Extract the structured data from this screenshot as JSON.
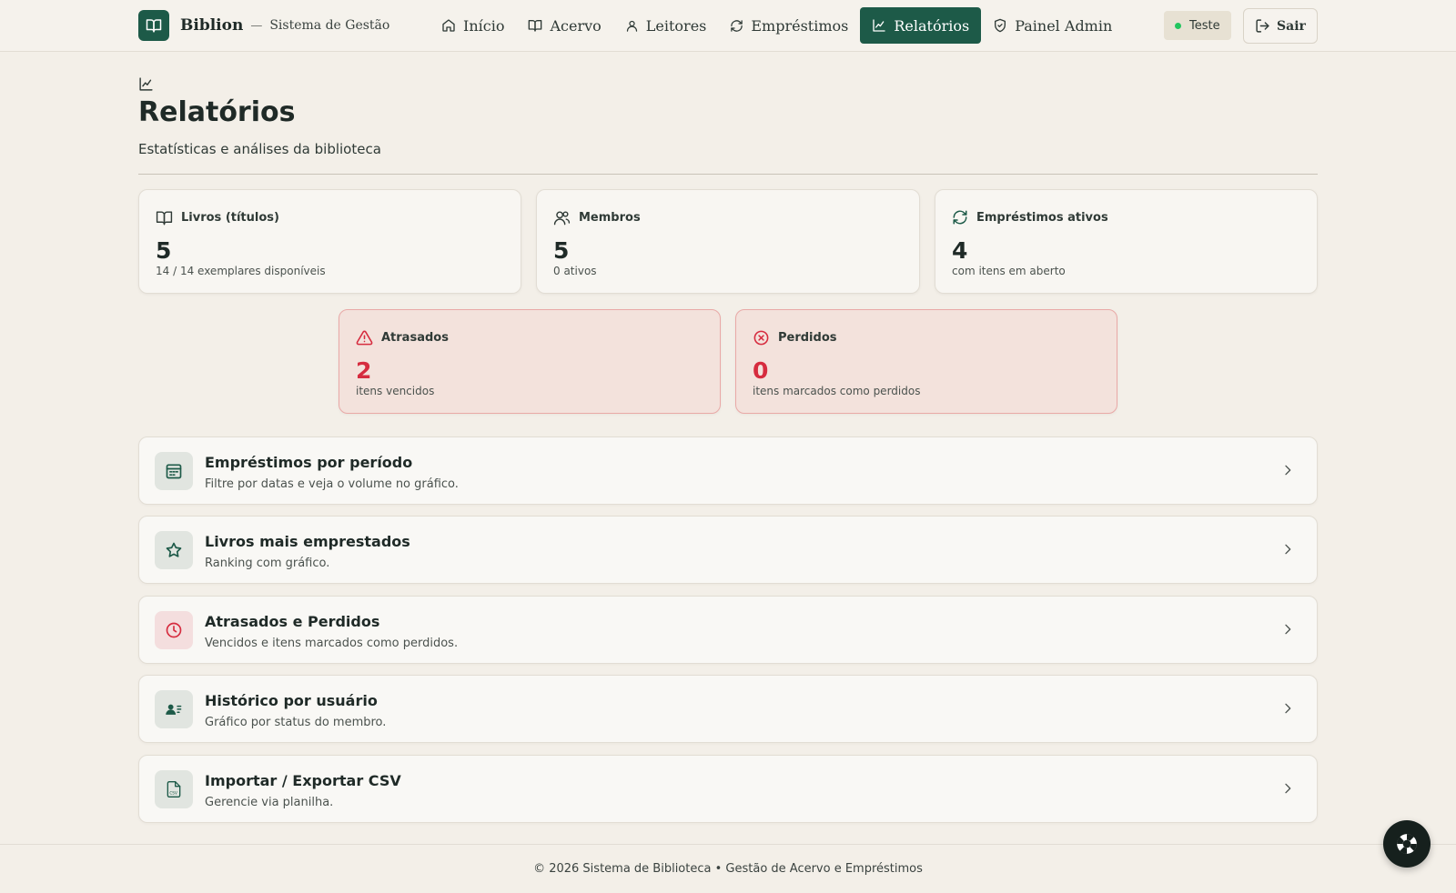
{
  "brand": {
    "name": "Biblion",
    "separator": "—",
    "subtitle": "Sistema de Gestão",
    "logo_icon": "book-open-icon"
  },
  "nav": {
    "items": [
      {
        "label": "Início",
        "icon": "home-icon",
        "active": false
      },
      {
        "label": "Acervo",
        "icon": "book-open-icon",
        "active": false
      },
      {
        "label": "Leitores",
        "icon": "user-icon",
        "active": false
      },
      {
        "label": "Empréstimos",
        "icon": "refresh-icon",
        "active": false
      },
      {
        "label": "Relatórios",
        "icon": "chart-line-icon",
        "active": true
      },
      {
        "label": "Painel Admin",
        "icon": "shield-check-icon",
        "active": false
      }
    ]
  },
  "env_badge": {
    "label": "Teste",
    "dot_color": "#22c55e"
  },
  "logout": {
    "label": "Sair",
    "icon": "logout-icon"
  },
  "header": {
    "title": "Relatórios",
    "subtitle": "Estatísticas e análises da biblioteca",
    "icon": "chart-line-icon"
  },
  "stats": [
    {
      "label": "Livros (títulos)",
      "value": "5",
      "note": "14 / 14 exemplares disponíveis",
      "icon": "book-open-icon"
    },
    {
      "label": "Membros",
      "value": "5",
      "note": "0 ativos",
      "icon": "users-icon"
    },
    {
      "label": "Empréstimos ativos",
      "value": "4",
      "note": "com itens em aberto",
      "icon": "refresh-icon"
    },
    {
      "label": "Atrasados",
      "value": "2",
      "note": "itens vencidos",
      "icon": "alert-triangle-icon"
    },
    {
      "label": "Perdidos",
      "value": "0",
      "note": "itens marcados como perdidos",
      "icon": "x-circle-icon"
    }
  ],
  "reports": [
    {
      "title": "Empréstimos por período",
      "desc": "Filtre por datas e veja o volume no gráfico.",
      "icon": "calendar-icon"
    },
    {
      "title": "Livros mais emprestados",
      "desc": "Ranking com gráfico.",
      "icon": "star-icon"
    },
    {
      "title": "Atrasados e Perdidos",
      "desc": "Vencidos e itens marcados como perdidos.",
      "icon": "clock-icon"
    },
    {
      "title": "Histórico por usuário",
      "desc": "Gráfico por status do membro.",
      "icon": "user-list-icon"
    },
    {
      "title": "Importar / Exportar CSV",
      "desc": "Gerencie via planilha.",
      "icon": "csv-file-icon"
    }
  ],
  "footer": {
    "text": "© 2026 Sistema de Biblioteca • Gestão de Acervo e Empréstimos"
  },
  "colors": {
    "primary": "#1d5a48",
    "background": "#f3efe8",
    "danger": "#d62c3f",
    "danger_bg": "#f3e2dc"
  },
  "help_button": {
    "icon": "lifebuoy-icon"
  }
}
